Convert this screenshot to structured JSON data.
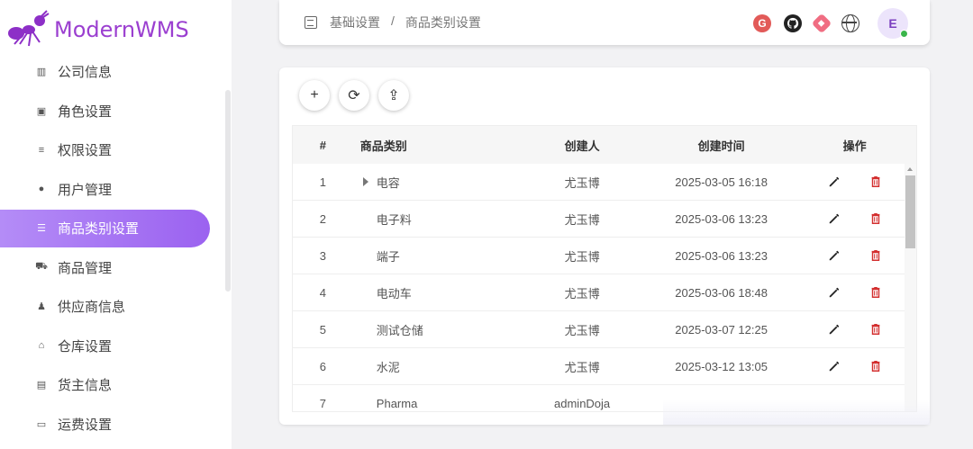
{
  "app": {
    "name": "ModernWMS"
  },
  "sidebar": {
    "items": [
      {
        "label": "公司信息",
        "icon": "building-icon"
      },
      {
        "label": "角色设置",
        "icon": "id-card-icon"
      },
      {
        "label": "权限设置",
        "icon": "menu-lines-icon"
      },
      {
        "label": "用户管理",
        "icon": "user-icon"
      },
      {
        "label": "商品类别设置",
        "icon": "list-icon",
        "active": true
      },
      {
        "label": "商品管理",
        "icon": "cart-icon"
      },
      {
        "label": "供应商信息",
        "icon": "supplier-icon"
      },
      {
        "label": "仓库设置",
        "icon": "warehouse-icon"
      },
      {
        "label": "货主信息",
        "icon": "owner-card-icon"
      },
      {
        "label": "运费设置",
        "icon": "money-icon"
      }
    ]
  },
  "header": {
    "breadcrumb": [
      "基础设置",
      "/",
      "商品类别设置"
    ],
    "icons": [
      "gitee-icon",
      "github-icon",
      "gitcode-icon",
      "globe-icon"
    ],
    "avatar_letter": "E",
    "status_color": "#3ab54a"
  },
  "toolbar": {
    "buttons": [
      {
        "name": "add-button",
        "glyph": "+"
      },
      {
        "name": "refresh-button",
        "glyph": "⟳"
      },
      {
        "name": "export-button",
        "glyph": "⇪"
      }
    ]
  },
  "table": {
    "columns": [
      "#",
      "商品类别",
      "创建人",
      "创建时间",
      "操作"
    ],
    "rows": [
      {
        "idx": "1",
        "category": "电容",
        "creator": "尤玉博",
        "time": "2025-03-05 16:18",
        "expandable": true
      },
      {
        "idx": "2",
        "category": "电子料",
        "creator": "尤玉博",
        "time": "2025-03-06 13:23"
      },
      {
        "idx": "3",
        "category": "端子",
        "creator": "尤玉博",
        "time": "2025-03-06 13:23"
      },
      {
        "idx": "4",
        "category": "电动车",
        "creator": "尤玉博",
        "time": "2025-03-06 18:48"
      },
      {
        "idx": "5",
        "category": "测试仓储",
        "creator": "尤玉博",
        "time": "2025-03-07 12:25"
      },
      {
        "idx": "6",
        "category": "水泥",
        "creator": "尤玉博",
        "time": "2025-03-12 13:05"
      },
      {
        "idx": "7",
        "category": "Pharma",
        "creator": "adminDoja",
        "time": ""
      }
    ]
  },
  "colors": {
    "brand": "#9b3fd0",
    "active_gradient_start": "#b48cf7",
    "active_gradient_end": "#9b62f0",
    "delete": "#d32f2f"
  }
}
